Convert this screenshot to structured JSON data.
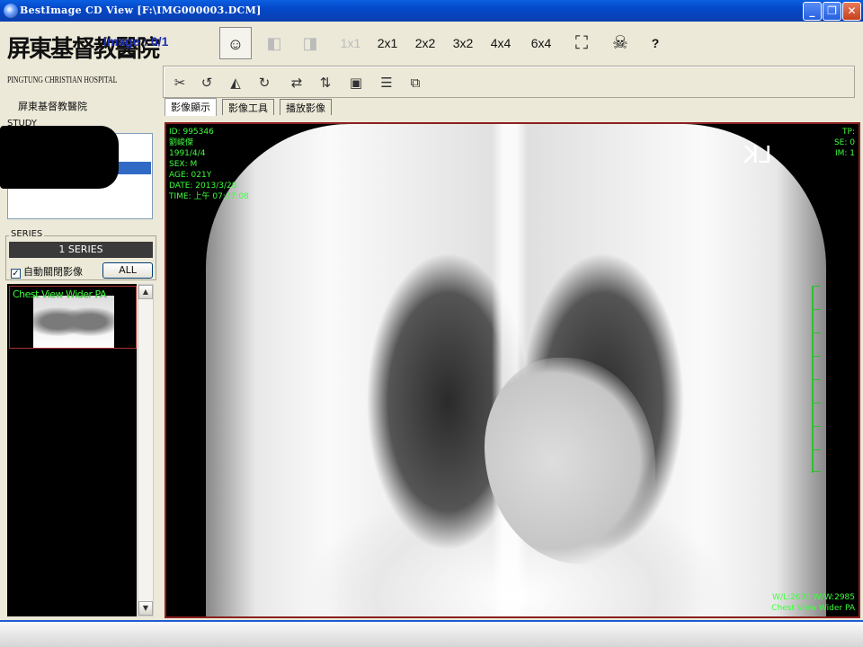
{
  "window": {
    "title": "BestImage CD View  [F:\\IMG000003.DCM]"
  },
  "logo": {
    "big": "屏東基督教醫院",
    "small": "PINGTUNG CHRISTIAN HOSPITAL"
  },
  "hospital_label": "屏東基督教醫院",
  "image_counter": "Image : 0/1",
  "layout_buttons": [
    "1x1",
    "2x1",
    "2x2",
    "3x2",
    "4x4",
    "6x4"
  ],
  "help_label": "?",
  "tabs": [
    "影像顯示",
    "影像工具",
    "播放影像"
  ],
  "study": {
    "label": "STUDY"
  },
  "series": {
    "label": "SERIES",
    "count": "1 SERIES",
    "auto_open": {
      "label": "自動關閉影像",
      "checked_mark": "✓"
    },
    "all_button": "ALL",
    "thumbnail_label": "Chest View Wider PA"
  },
  "overlay": {
    "id": "ID: 995346",
    "name": "劉峻傑",
    "dob": "1991/4/4",
    "sex": "SEX: M",
    "age": "AGE: 021Y",
    "date": "DATE: 2013/3/28",
    "time": "TIME: 上午 07:37:08",
    "tp": "TP:",
    "se": "SE: 0",
    "im": "IM: 1",
    "wl_ww": "W/L:2603 W/W:2985",
    "series_name": "Chest View Wider PA",
    "side_marker": "LK"
  }
}
